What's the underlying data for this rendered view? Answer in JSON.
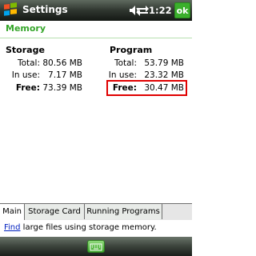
{
  "titlebar": {
    "title": "Settings",
    "time": "1:22",
    "ok_label": "ok"
  },
  "header": {
    "label": "Memory"
  },
  "storage": {
    "title": "Storage",
    "total_label": "Total:",
    "total_value": "80.56 MB",
    "inuse_label": "In use:",
    "inuse_value": "7.17 MB",
    "free_label": "Free:",
    "free_value": "73.39 MB"
  },
  "program": {
    "title": "Program",
    "total_label": "Total:",
    "total_value": "53.79 MB",
    "inuse_label": "In use:",
    "inuse_value": "23.32 MB",
    "free_label": "Free:",
    "free_value": "30.47 MB"
  },
  "tabs": [
    {
      "label": "Main",
      "active": true
    },
    {
      "label": "Storage Card",
      "active": false
    },
    {
      "label": "Running Programs",
      "active": false
    }
  ],
  "find": {
    "link_text": "Find",
    "rest_text": " large files using storage memory."
  },
  "colors": {
    "accent": "#35a62a",
    "highlight": "#e00000",
    "link": "#0020c0"
  }
}
